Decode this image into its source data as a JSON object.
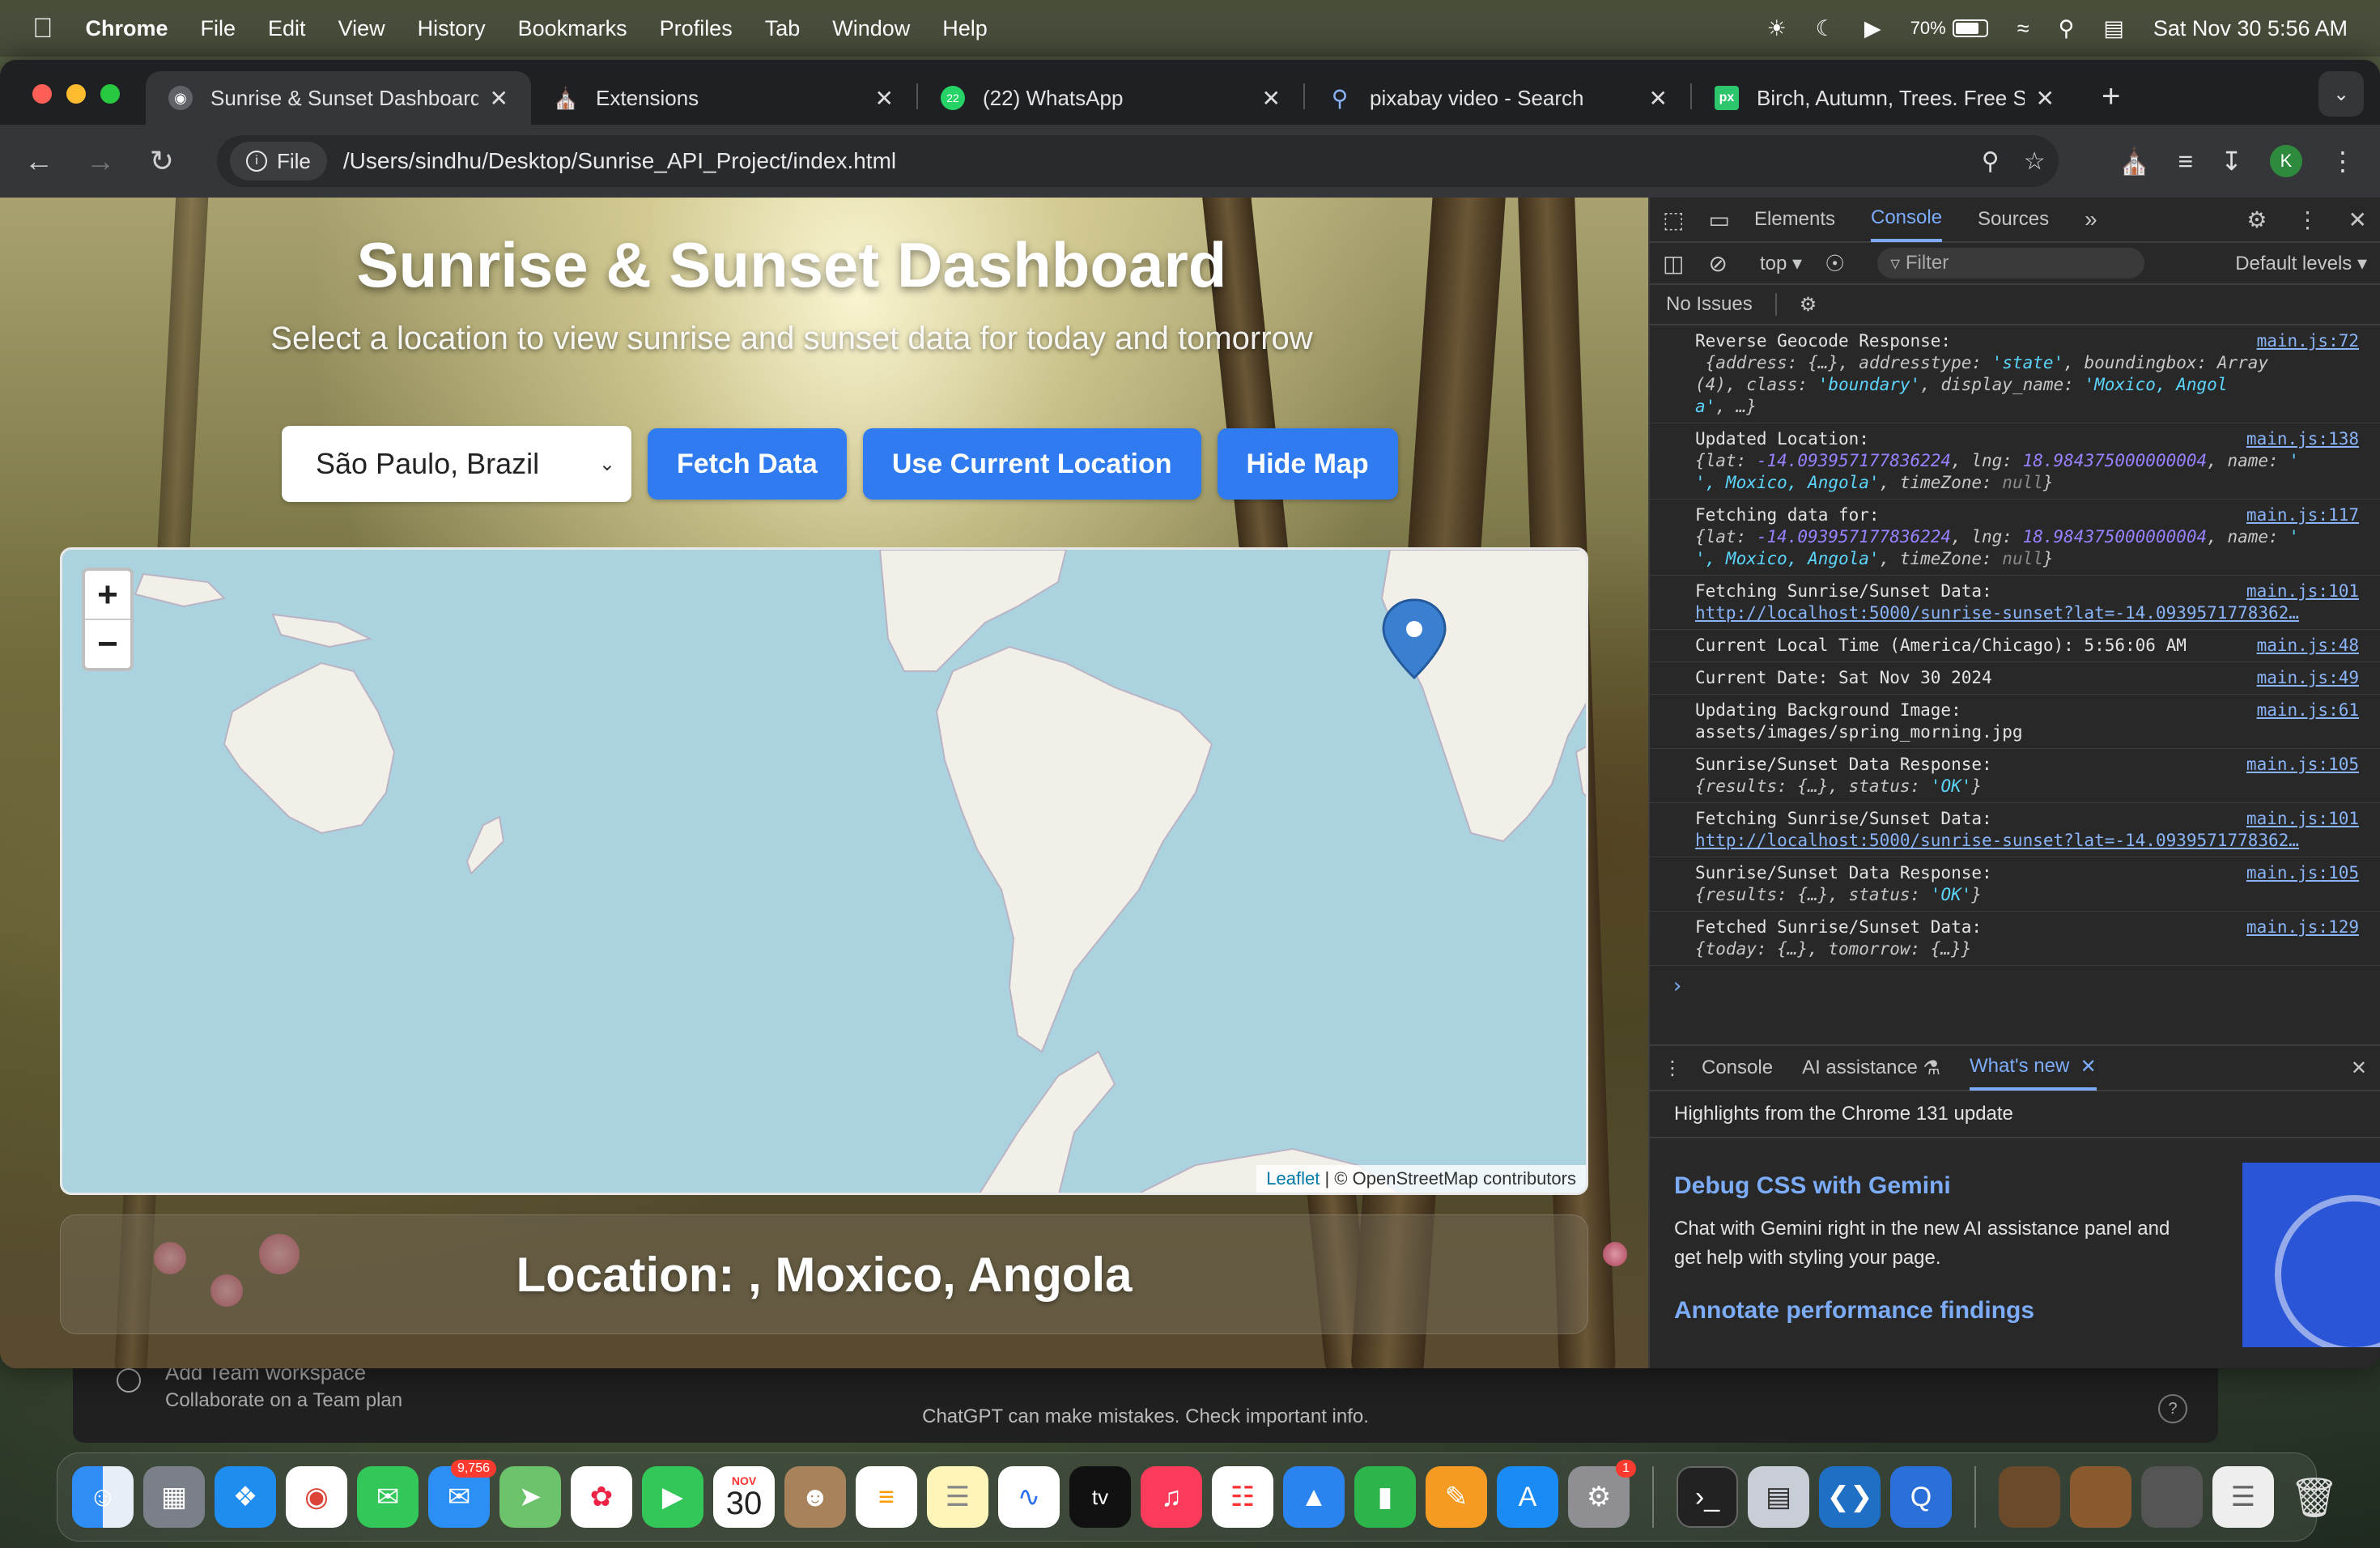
{
  "menubar": {
    "app_name": "Chrome",
    "items": [
      "File",
      "Edit",
      "View",
      "History",
      "Bookmarks",
      "Profiles",
      "Tab",
      "Window",
      "Help"
    ],
    "battery": "70%",
    "datetime": "Sat Nov 30  5:56 AM"
  },
  "browser": {
    "tabs": [
      {
        "title": "Sunrise & Sunset Dashboard",
        "icon": "globe-icon"
      },
      {
        "title": "Extensions",
        "icon": "puzzle-icon"
      },
      {
        "title": "(22) WhatsApp",
        "icon": "whatsapp-icon",
        "badge": "22"
      },
      {
        "title": "pixabay video - Search",
        "icon": "search-icon"
      },
      {
        "title": "Birch, Autumn, Trees. Free St",
        "icon": "pixabay-icon",
        "favicon_text": "px"
      }
    ],
    "address": {
      "chip_label": "File",
      "url": "/Users/sindhu/Desktop/Sunrise_API_Project/index.html"
    },
    "profile_initial": "K"
  },
  "page": {
    "title": "Sunrise & Sunset Dashboard",
    "subtitle": "Select a location to view sunrise and sunset data for today and tomorrow",
    "location_select": {
      "value": "São Paulo, Brazil"
    },
    "buttons": {
      "fetch": "Fetch Data",
      "current_location": "Use Current Location",
      "hide_map": "Hide Map"
    },
    "map": {
      "zoom_in": "+",
      "zoom_out": "−",
      "attribution_link": "Leaflet",
      "attribution_text": " | © OpenStreetMap contributors"
    },
    "location_label": "Location: , Moxico, Angola"
  },
  "devtools": {
    "tabs": [
      "Elements",
      "Console",
      "Sources"
    ],
    "active_tab": "Console",
    "context": "top",
    "filter_placeholder": "Filter",
    "levels": "Default levels",
    "issues": "No Issues",
    "logs": [
      {
        "msg": "Reverse Geocode Response:",
        "src": "main.js:72"
      },
      {
        "msg": "Updated Location:",
        "src": "main.js:138"
      },
      {
        "msg": "Fetching data for:",
        "src": "main.js:117"
      },
      {
        "msg": "Fetching Sunrise/Sunset Data:",
        "src": "main.js:101",
        "link": "http://localhost:5000/sunrise-sunset?lat=-14.0939571778362…"
      },
      {
        "msg": "Current Local Time (America/Chicago): 5:56:06 AM",
        "src": "main.js:48"
      },
      {
        "msg": "Current Date: Sat Nov 30 2024",
        "src": "main.js:49"
      },
      {
        "msg": "Updating Background Image:",
        "src": "main.js:61",
        "line2": "assets/images/spring_morning.jpg"
      },
      {
        "msg": "Sunrise/Sunset Data Response:",
        "src": "main.js:105"
      },
      {
        "msg": "Fetching Sunrise/Sunset Data:",
        "src": "main.js:101",
        "link": "http://localhost:5000/sunrise-sunset?lat=-14.0939571778362…"
      },
      {
        "msg": "Sunrise/Sunset Data Response:",
        "src": "main.js:105"
      },
      {
        "msg": "Fetched Sunrise/Sunset Data:",
        "src": "main.js:129"
      }
    ],
    "geocode_obj": {
      "line1": "{address: {…}, addresstype: ",
      "line1_str": "'state'",
      "line1_rest": ", boundingbox: Array",
      "line2": "(4), class: ",
      "line2_str": "'boundary'",
      "line2_rest": ", display_name: ",
      "line2_str2": "'Moxico, Angol",
      "line3_str": "a'",
      "line3_rest": ", …}"
    },
    "loc_obj": {
      "pre": "{lat: ",
      "lat": "-14.093957177836224",
      "mid": ", lng: ",
      "lng": "18.984375000000004",
      "post": ", name: ",
      "name_start": "'",
      "name_end": "', Moxico, Angola'",
      "tz": ", timeZone: ",
      "tz_val": "null",
      "close": "}"
    },
    "response_obj": {
      "pre": "{results: {…}, status: ",
      "status": "'OK'",
      "close": "}"
    },
    "fetched_obj": "{today: {…}, tomorrow: {…}}",
    "drawer": {
      "tabs": [
        "Console",
        "AI assistance",
        "What's new"
      ],
      "highlight": "Highlights from the Chrome 131 update",
      "feature1_title": "Debug CSS with Gemini",
      "feature1_text": "Chat with Gemini right in the new AI assistance panel and get help with styling your page.",
      "feature2_title": "Annotate performance findings"
    }
  },
  "background_app": {
    "workspace_title": "Add Team workspace",
    "workspace_sub": "Collaborate on a Team plan",
    "disclaimer": "ChatGPT can make mistakes. Check important info.",
    "help": "?"
  },
  "dock": {
    "mail_badge": "9,756",
    "settings_badge": "1",
    "calendar_month": "NOV",
    "calendar_day": "30",
    "tv_label": "tv"
  }
}
